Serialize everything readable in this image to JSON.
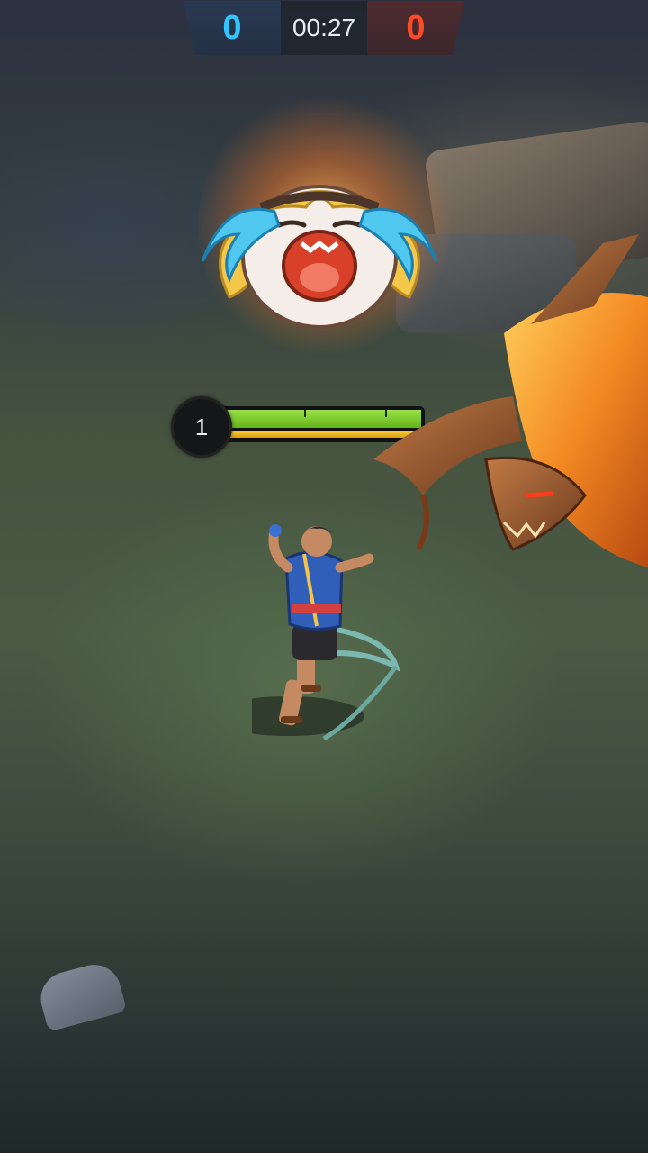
{
  "scoreboard": {
    "blue_score": "0",
    "timer": "00:27",
    "red_score": "0"
  },
  "hero_status": {
    "level": "1",
    "hp_fraction": 1.0,
    "mana_fraction": 1.0
  },
  "emote": {
    "icon": "crying-emote-icon"
  },
  "colors": {
    "blue_team": "#31c5ff",
    "red_team": "#ff4a2a",
    "hp": "#7cc832",
    "mana": "#f2b822"
  }
}
